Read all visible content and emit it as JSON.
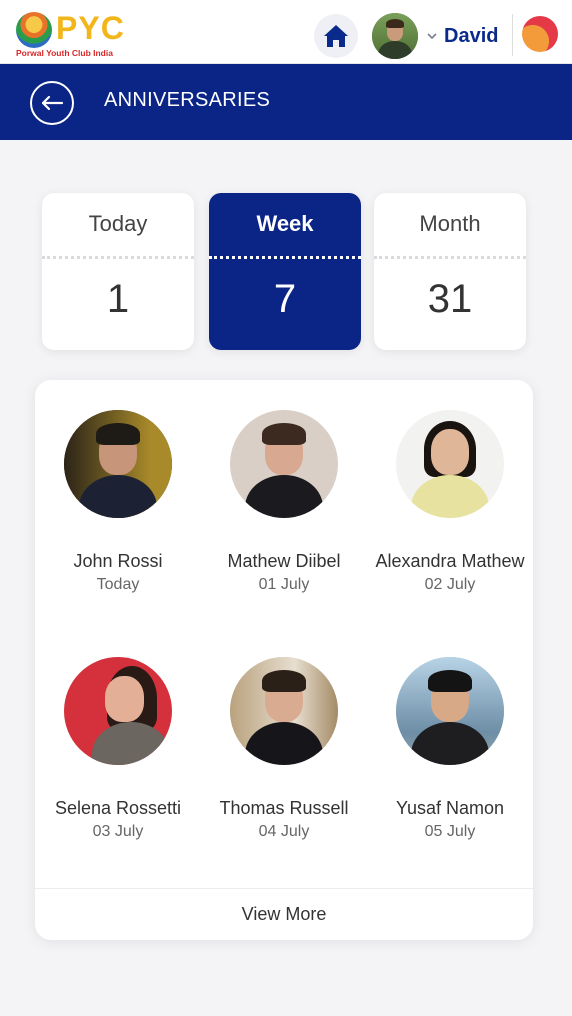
{
  "header": {
    "logo_text": "PYC",
    "logo_subtitle": "Porwal Youth Club India",
    "user_name": "David"
  },
  "titlebar": {
    "title": "ANNIVERSARIES"
  },
  "stats": [
    {
      "label": "Today",
      "value": "1",
      "active": false
    },
    {
      "label": "Week",
      "value": "7",
      "active": true
    },
    {
      "label": "Month",
      "value": "31",
      "active": false
    }
  ],
  "people": [
    {
      "name": "John Rossi",
      "date": "Today"
    },
    {
      "name": "Mathew Diibel",
      "date": "01 July"
    },
    {
      "name": "Alexandra Mathew",
      "date": "02 July"
    },
    {
      "name": "Selena Rossetti",
      "date": "03 July"
    },
    {
      "name": "Thomas Russell",
      "date": "04 July"
    },
    {
      "name": "Yusaf Namon",
      "date": "05 July"
    }
  ],
  "footer": {
    "view_more": "View More"
  },
  "colors": {
    "primary": "#0b2587",
    "logo_yellow": "#f2b61b",
    "user_name": "#0b2b8c"
  },
  "icons": {
    "home": "home-icon",
    "back": "arrow-left-icon",
    "chevron": "chevron-down-icon"
  }
}
